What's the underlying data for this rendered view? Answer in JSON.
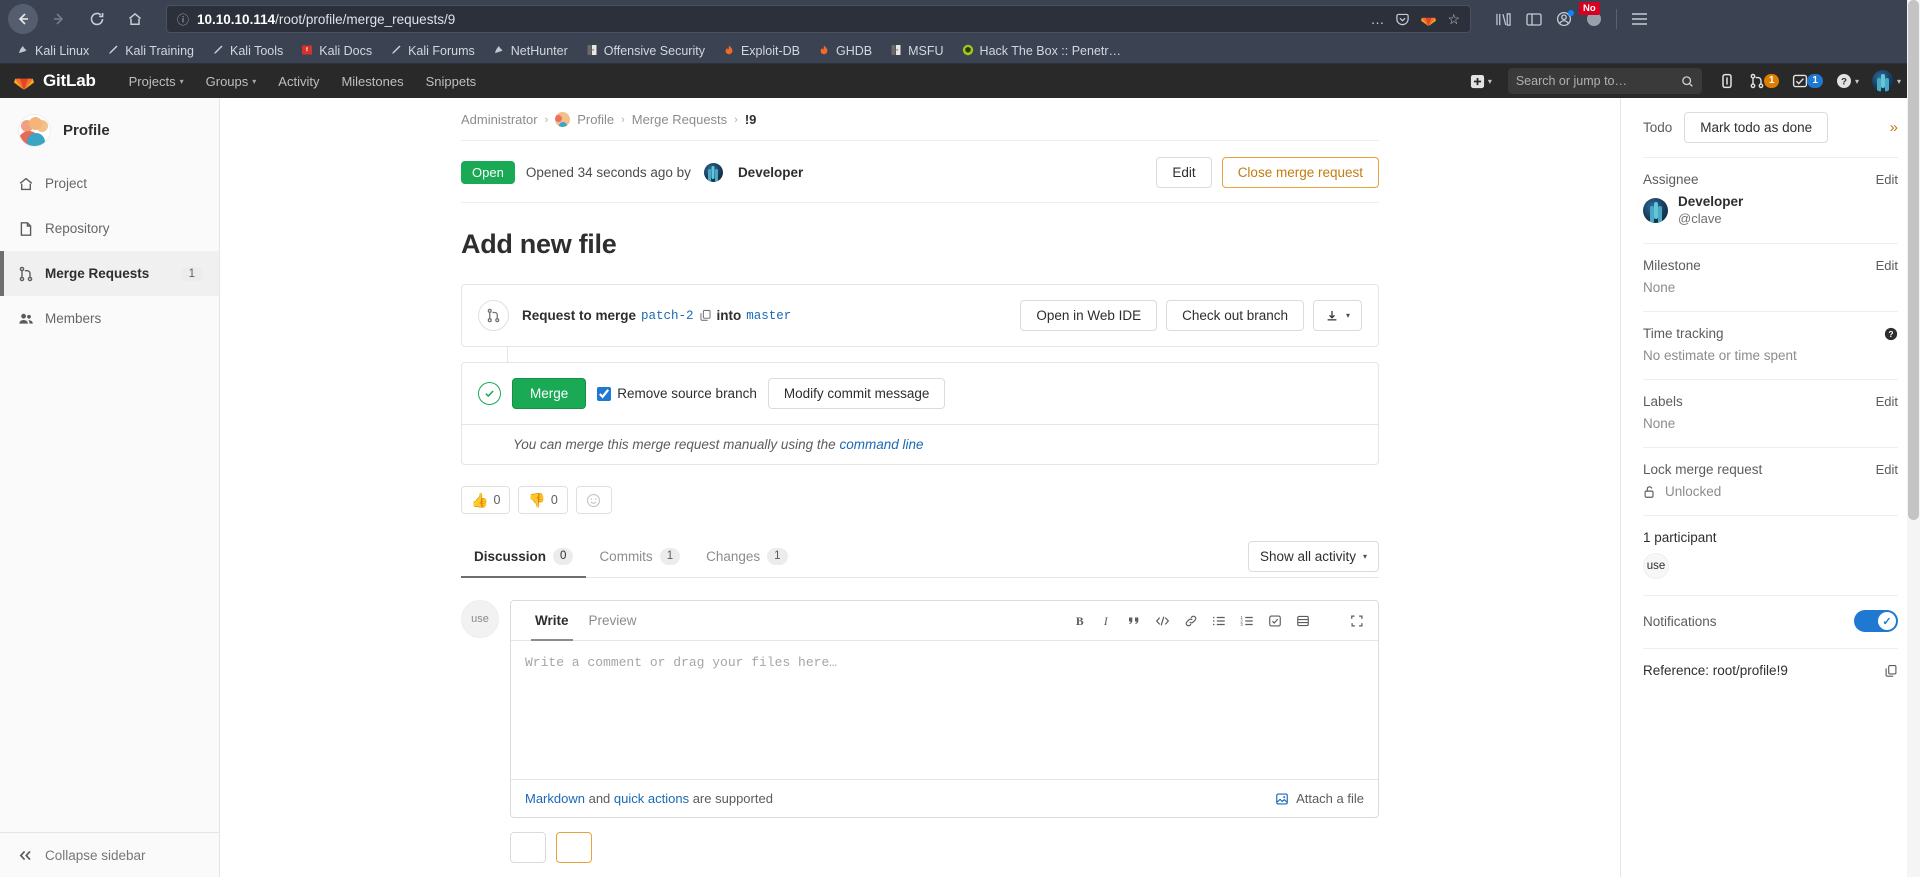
{
  "browser": {
    "url_host": "10.10.10.114",
    "url_path": "/root/profile/merge_requests/9",
    "back_icon": "back-arrow-icon",
    "forward_icon": "forward-arrow-icon",
    "reload_icon": "reload-icon",
    "home_icon": "home-icon",
    "notification_badge": "No",
    "bookmarks": [
      {
        "label": "Kali Linux",
        "icon": "dragon"
      },
      {
        "label": "Kali Training",
        "icon": "pen"
      },
      {
        "label": "Kali Tools",
        "icon": "pen"
      },
      {
        "label": "Kali Docs",
        "icon": "book-red"
      },
      {
        "label": "Kali Forums",
        "icon": "pen"
      },
      {
        "label": "NetHunter",
        "icon": "dragon"
      },
      {
        "label": "Offensive Security",
        "icon": "door"
      },
      {
        "label": "Exploit-DB",
        "icon": "flame"
      },
      {
        "label": "GHDB",
        "icon": "flame"
      },
      {
        "label": "MSFU",
        "icon": "door"
      },
      {
        "label": "Hack The Box :: Penetr…",
        "icon": "htb"
      }
    ]
  },
  "gitlab_nav": {
    "brand": "GitLab",
    "items": [
      {
        "label": "Projects",
        "caret": true
      },
      {
        "label": "Groups",
        "caret": true
      },
      {
        "label": "Activity",
        "caret": false
      },
      {
        "label": "Milestones",
        "caret": false
      },
      {
        "label": "Snippets",
        "caret": false
      }
    ],
    "search_placeholder": "Search or jump to…",
    "search_value": "",
    "merge_requests_count": "1",
    "todos_count": "1"
  },
  "sidebar": {
    "project_name": "Profile",
    "items": [
      {
        "label": "Project",
        "icon": "home-icon",
        "count": "",
        "active": false
      },
      {
        "label": "Repository",
        "icon": "document-icon",
        "count": "",
        "active": false
      },
      {
        "label": "Merge Requests",
        "icon": "merge-request-icon",
        "count": "1",
        "active": true
      },
      {
        "label": "Members",
        "icon": "users-icon",
        "count": "",
        "active": false
      }
    ],
    "collapse_label": "Collapse sidebar"
  },
  "breadcrumb": {
    "items": [
      "Administrator",
      "Profile",
      "Merge Requests",
      "!9"
    ]
  },
  "merge_request": {
    "state_badge": "Open",
    "opened_text": "Opened 34 seconds ago by",
    "author": "Developer",
    "edit_label": "Edit",
    "close_label": "Close merge request",
    "title": "Add new file",
    "request_to_merge": "Request to merge",
    "source_branch": "patch-2",
    "into_word": "into",
    "target_branch": "master",
    "open_web_ide": "Open in Web IDE",
    "check_out_branch": "Check out branch",
    "merge_button": "Merge",
    "remove_source_branch": "Remove source branch",
    "remove_source_branch_checked": true,
    "modify_commit_message": "Modify commit message",
    "manual_note_prefix": "You can merge this merge request manually using the",
    "manual_note_link": "command line",
    "reactions": [
      {
        "emoji": "👍",
        "count": "0",
        "name": "thumbsup-reaction"
      },
      {
        "emoji": "👎",
        "count": "0",
        "name": "thumbsdown-reaction"
      }
    ],
    "add_reaction_icon": "smiley-icon"
  },
  "tabs": [
    {
      "label": "Discussion",
      "count": "0",
      "active": true
    },
    {
      "label": "Commits",
      "count": "1",
      "active": false
    },
    {
      "label": "Changes",
      "count": "1",
      "active": false
    }
  ],
  "activity_filter": "Show all activity",
  "comment_form": {
    "avatar_text": "use",
    "write_tab": "Write",
    "preview_tab": "Preview",
    "placeholder": "Write a comment or drag your files here…",
    "value": "",
    "toolbar": [
      {
        "name": "bold-icon",
        "glyph": "B"
      },
      {
        "name": "italic-icon",
        "glyph": "I"
      },
      {
        "name": "quote-icon",
        "glyph": "❞"
      },
      {
        "name": "code-icon",
        "glyph": "</>"
      },
      {
        "name": "link-icon",
        "glyph": "🔗"
      },
      {
        "name": "bullet-list-icon",
        "glyph": "☰"
      },
      {
        "name": "numbered-list-icon",
        "glyph": "≡"
      },
      {
        "name": "task-list-icon",
        "glyph": "☑"
      },
      {
        "name": "table-icon",
        "glyph": "▤"
      },
      {
        "name": "fullscreen-icon",
        "glyph": "⛶"
      }
    ],
    "markdown_label": "Markdown",
    "and_word": "and",
    "quick_actions_label": "quick actions",
    "supported_text": "are supported",
    "attach_label": "Attach a file"
  },
  "right_sidebar": {
    "todo_label": "Todo",
    "mark_todo_done": "Mark todo as done",
    "collapse_icon": "double-chevron-right-icon",
    "assignee_title": "Assignee",
    "assignee_edit": "Edit",
    "assignee_name": "Developer",
    "assignee_username": "@clave",
    "milestone_title": "Milestone",
    "milestone_edit": "Edit",
    "milestone_value": "None",
    "time_tracking_title": "Time tracking",
    "time_tracking_value": "No estimate or time spent",
    "time_tracking_help_icon": "question-circle-icon",
    "labels_title": "Labels",
    "labels_edit": "Edit",
    "labels_value": "None",
    "lock_title": "Lock merge request",
    "lock_edit": "Edit",
    "lock_value": "Unlocked",
    "lock_icon": "unlock-icon",
    "participants_title": "1 participant",
    "participant_avatar_text": "use",
    "notifications_title": "Notifications",
    "notifications_enabled": true,
    "reference_text": "Reference: root/profile!9",
    "reference_copy_icon": "copy-icon"
  },
  "colors": {
    "gitlab_orange": "#e24329",
    "open_green": "#1aaa55",
    "link_blue": "#1b69b6",
    "warning_orange": "#e9a13b",
    "toggle_blue": "#1f78d1"
  }
}
